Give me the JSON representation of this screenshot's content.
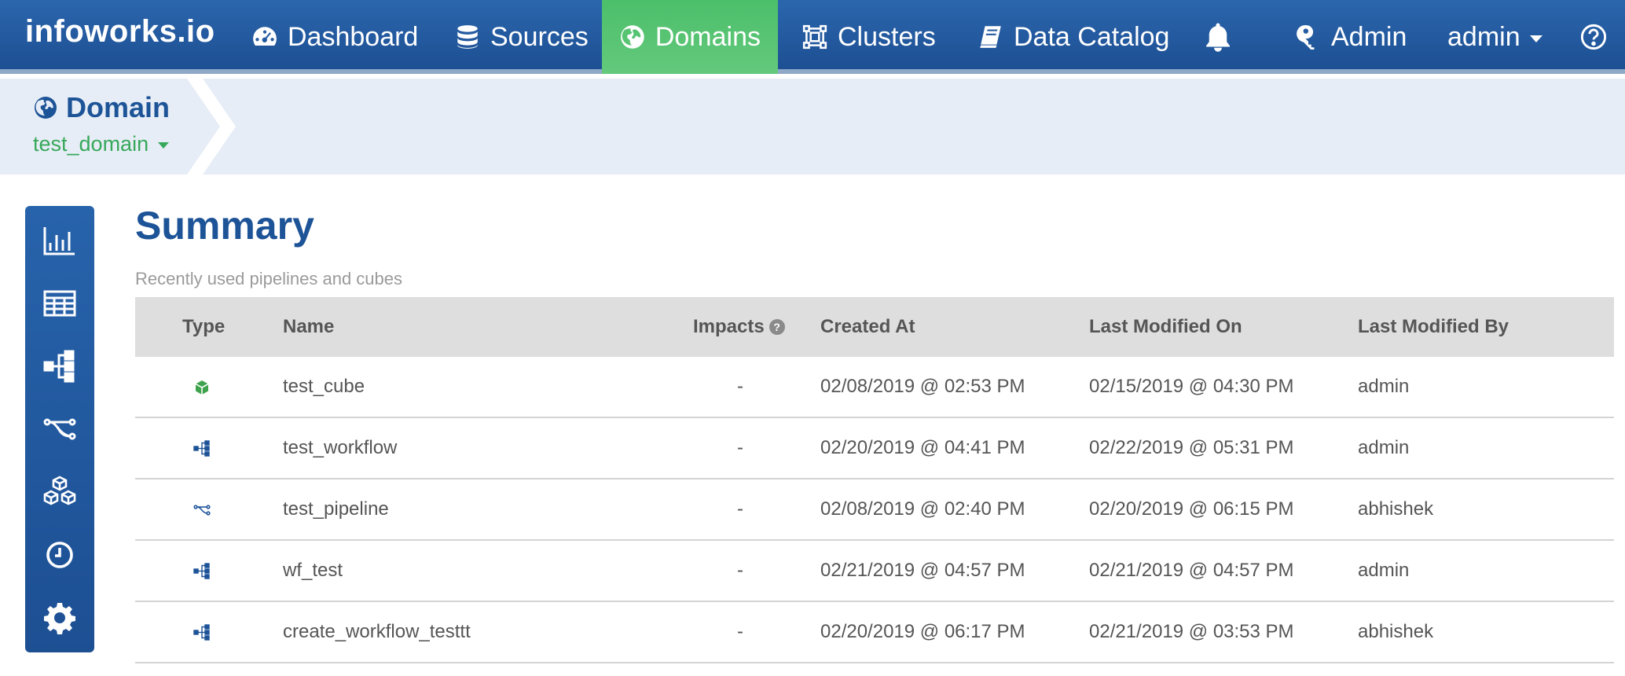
{
  "navbar": {
    "brand": "infoworks.io",
    "items": [
      {
        "label": "Dashboard",
        "icon": "dashboard-gauge-icon"
      },
      {
        "label": "Sources",
        "icon": "database-icon"
      },
      {
        "label": "Domains",
        "icon": "globe-icon",
        "active": true
      },
      {
        "label": "Clusters",
        "icon": "cluster-icon"
      },
      {
        "label": "Data Catalog",
        "icon": "book-icon"
      }
    ],
    "notifications_icon": "bell-icon",
    "admin_label": "Admin",
    "user_label": "admin",
    "help_icon": "question-circle-icon",
    "active_color": "#52c270",
    "bar_color": "#2460a7"
  },
  "breadcrumb": {
    "title": "Domain",
    "selected_domain": "test_domain"
  },
  "sidebar": {
    "items": [
      {
        "name": "summary",
        "icon": "bar-chart-icon"
      },
      {
        "name": "tables",
        "icon": "table-grid-icon"
      },
      {
        "name": "workflows",
        "icon": "workflow-tree-icon"
      },
      {
        "name": "pipelines",
        "icon": "pipeline-icon"
      },
      {
        "name": "cubes",
        "icon": "cubes-icon"
      },
      {
        "name": "history",
        "icon": "clock-icon"
      },
      {
        "name": "settings",
        "icon": "gear-icon"
      }
    ]
  },
  "main": {
    "title": "Summary",
    "subtitle": "Recently used pipelines and cubes"
  },
  "table": {
    "headers": {
      "type": "Type",
      "name": "Name",
      "impacts": "Impacts",
      "created_at": "Created At",
      "last_modified_on": "Last Modified On",
      "last_modified_by": "Last Modified By"
    },
    "rows": [
      {
        "type": "cube",
        "name": "test_cube",
        "impacts": "-",
        "created_at": "02/08/2019 @ 02:53 PM",
        "last_modified_on": "02/15/2019 @ 04:30 PM",
        "last_modified_by": "admin"
      },
      {
        "type": "workflow",
        "name": "test_workflow",
        "impacts": "-",
        "created_at": "02/20/2019 @ 04:41 PM",
        "last_modified_on": "02/22/2019 @ 05:31 PM",
        "last_modified_by": "admin"
      },
      {
        "type": "pipeline",
        "name": "test_pipeline",
        "impacts": "-",
        "created_at": "02/08/2019 @ 02:40 PM",
        "last_modified_on": "02/20/2019 @ 06:15 PM",
        "last_modified_by": "abhishek"
      },
      {
        "type": "workflow",
        "name": "wf_test",
        "impacts": "-",
        "created_at": "02/21/2019 @ 04:57 PM",
        "last_modified_on": "02/21/2019 @ 04:57 PM",
        "last_modified_by": "admin"
      },
      {
        "type": "workflow",
        "name": "create_workflow_testtt",
        "impacts": "-",
        "created_at": "02/20/2019 @ 06:17 PM",
        "last_modified_on": "02/21/2019 @ 03:53 PM",
        "last_modified_by": "abhishek"
      }
    ]
  }
}
